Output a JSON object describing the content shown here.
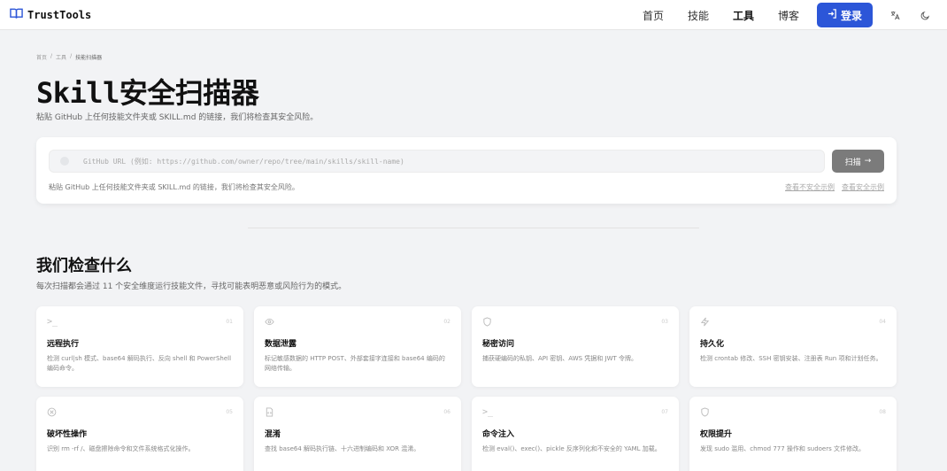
{
  "nav": {
    "brand": "TrustTools",
    "links": [
      "首页",
      "技能",
      "工具",
      "博客"
    ],
    "active_link": "工具",
    "login": "登录",
    "translate_icon": "translate-icon",
    "theme_icon": "moon-icon"
  },
  "breadcrumb": [
    "首页",
    "工具",
    "技能扫描器"
  ],
  "page": {
    "title": "Skill安全扫描器",
    "subtitle": "粘贴 GitHub 上任何技能文件夹或 SKILL.md 的链接，我们将检查其安全风险。"
  },
  "scanner": {
    "placeholder": "GitHub URL (例如: https://github.com/owner/repo/tree/main/skills/skill-name)",
    "value": "",
    "button": "扫描",
    "hint": "粘贴 GitHub 上任何技能文件夹或 SKILL.md 的链接，我们将检查其安全风险。",
    "unsafe_example": "查看不安全示例",
    "safe_example": "查看安全示例"
  },
  "checks": {
    "title": "我们检查什么",
    "subtitle": "每次扫描都会通过 11 个安全维度运行技能文件，寻找可能表明恶意或风险行为的模式。",
    "cards": [
      {
        "num": "01",
        "icon": "terminal-icon",
        "title": "远程执行",
        "desc": "检测 curl|sh 模式、base64 解码执行、反向 shell 和 PowerShell 编码命令。"
      },
      {
        "num": "02",
        "icon": "eye-icon",
        "title": "数据泄露",
        "desc": "标记敏感数据的 HTTP POST、外部套接字连接和 base64 编码的网络传输。"
      },
      {
        "num": "03",
        "icon": "shield-icon",
        "title": "秘密访问",
        "desc": "捕获硬编码的私钥、API 密钥、AWS 凭据和 JWT 令牌。"
      },
      {
        "num": "04",
        "icon": "bolt-icon",
        "title": "持久化",
        "desc": "检测 crontab 修改、SSH 密钥安装、注册表 Run 项和计划任务。"
      },
      {
        "num": "05",
        "icon": "x-circle-icon",
        "title": "破坏性操作",
        "desc": "识别 rm -rf /、磁盘擦除命令和文件系统格式化操作。"
      },
      {
        "num": "06",
        "icon": "file-code-icon",
        "title": "混淆",
        "desc": "查找 base64 解码执行链、十六进制编码和 XOR 混淆。"
      },
      {
        "num": "07",
        "icon": "terminal-icon",
        "title": "命令注入",
        "desc": "检测 eval()、exec()、pickle 反序列化和不安全的 YAML 加载。"
      },
      {
        "num": "08",
        "icon": "shield-icon",
        "title": "权限提升",
        "desc": "发现 sudo 滥用、chmod 777 操作和 sudoers 文件修改。"
      }
    ]
  },
  "colors": {
    "accent": "#2c56d8",
    "background": "#f2f3f5",
    "scan_button": "#7b7b7b"
  }
}
